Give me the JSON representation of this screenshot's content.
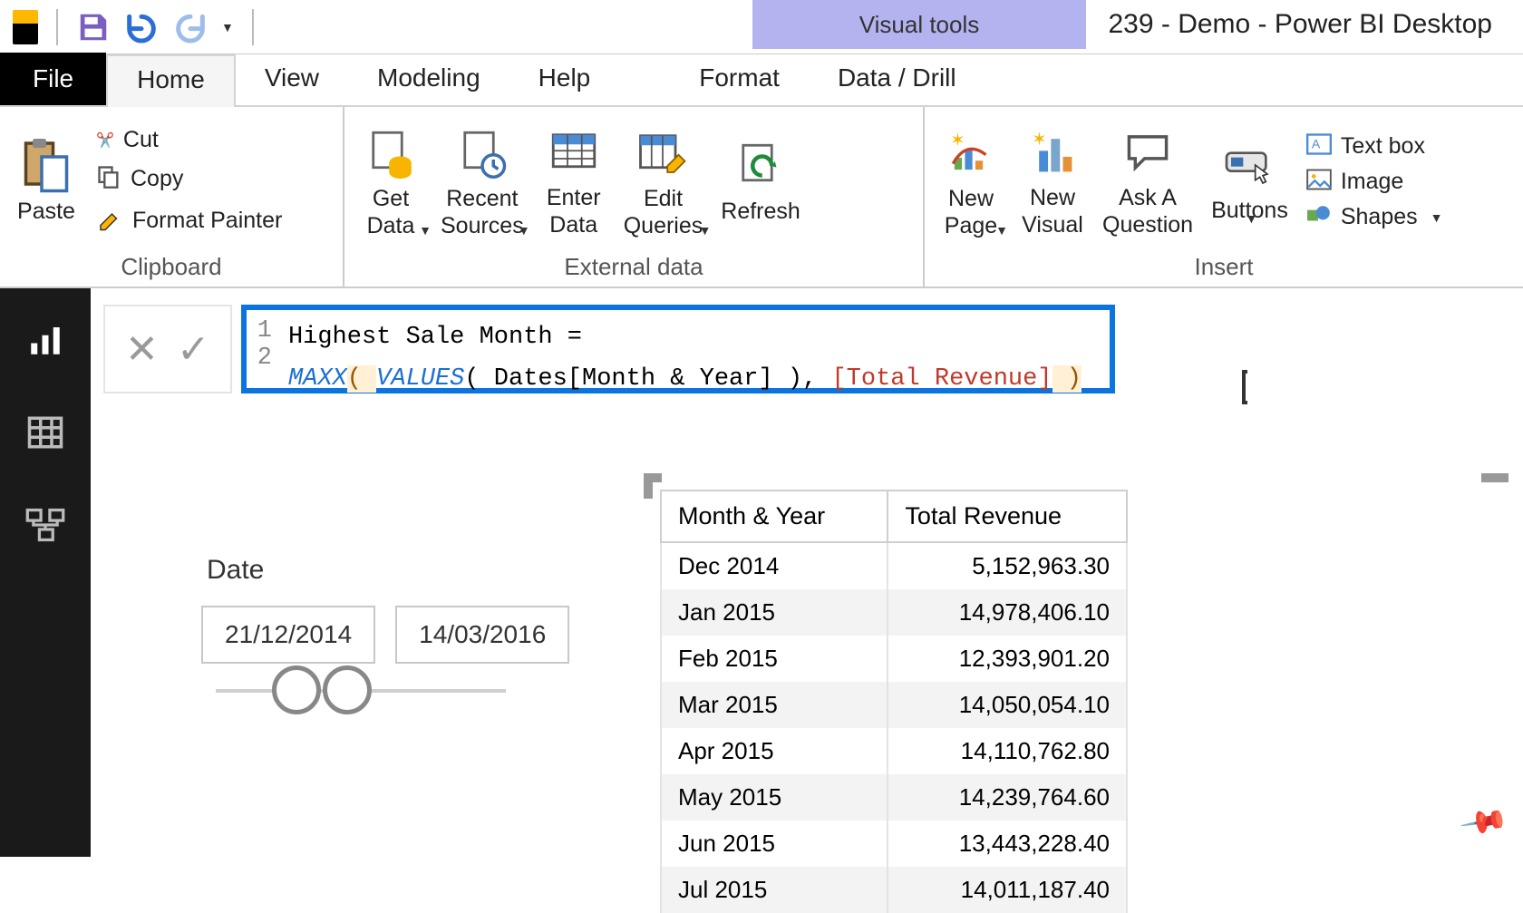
{
  "title_bar": {
    "contextual": "Visual tools",
    "app": "239 - Demo - Power BI Desktop"
  },
  "tabs": {
    "file": "File",
    "home": "Home",
    "view": "View",
    "modeling": "Modeling",
    "help": "Help",
    "format": "Format",
    "data_drill": "Data / Drill"
  },
  "ribbon": {
    "paste": "Paste",
    "cut": "Cut",
    "copy": "Copy",
    "format_painter": "Format Painter",
    "clipboard_group": "Clipboard",
    "get_data": "Get\nData",
    "recent_sources": "Recent\nSources",
    "enter_data": "Enter\nData",
    "edit_queries": "Edit\nQueries",
    "refresh": "Refresh",
    "external_group": "External data",
    "new_page": "New\nPage",
    "new_visual": "New\nVisual",
    "ask_q": "Ask A\nQuestion",
    "buttons": "Buttons",
    "text_box": "Text box",
    "image": "Image",
    "shapes": "Shapes",
    "insert_group": "Insert"
  },
  "formula": {
    "line1": "Highest Sale Month =",
    "line2_fn": "MAXX",
    "line2_mid": "( ",
    "line2_vals": "VALUES",
    "line2_tail1": "( Dates[Month & Year] ), ",
    "line2_meas": "[Total Revenue]",
    "line2_end": " )"
  },
  "date_slicer": {
    "title": "Date",
    "from": "21/12/2014",
    "to": "14/03/2016"
  },
  "table": {
    "headers": [
      "Month & Year",
      "Total Revenue"
    ],
    "rows": [
      [
        "Dec 2014",
        "5,152,963.30"
      ],
      [
        "Jan 2015",
        "14,978,406.10"
      ],
      [
        "Feb 2015",
        "12,393,901.20"
      ],
      [
        "Mar 2015",
        "14,050,054.10"
      ],
      [
        "Apr 2015",
        "14,110,762.80"
      ],
      [
        "May 2015",
        "14,239,764.60"
      ],
      [
        "Jun 2015",
        "13,443,228.40"
      ],
      [
        "Jul 2015",
        "14,011,187.40"
      ]
    ]
  }
}
